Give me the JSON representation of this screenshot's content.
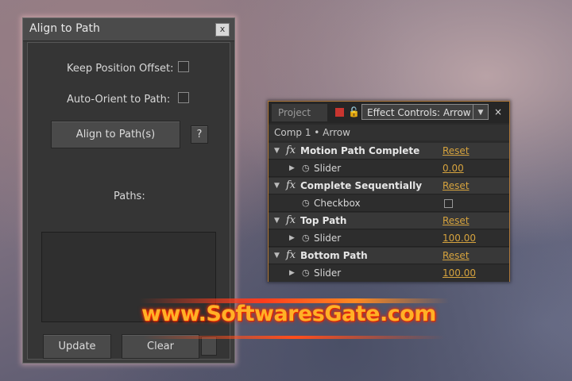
{
  "align_dialog": {
    "title": "Align to Path",
    "close_glyph": "x",
    "keep_position_offset_label": "Keep Position Offset:",
    "keep_position_offset_checked": false,
    "auto_orient_label": "Auto-Orient to Path:",
    "auto_orient_checked": false,
    "align_button_label": "Align to Path(s)",
    "help_button_label": "?",
    "paths_label": "Paths:",
    "update_button_label": "Update",
    "clear_button_label": "Clear"
  },
  "effect_controls": {
    "project_tab": "Project",
    "active_tab": "Effect Controls: Arrow",
    "tab_menu_glyph": "▼",
    "close_glyph": "×",
    "lock_icon": "lock-icon",
    "layer_header": "Comp 1 • Arrow",
    "effects": [
      {
        "name": "Motion Path Complete",
        "reset": "Reset",
        "prop": "Slider",
        "value": "0.00",
        "is_checkbox": false
      },
      {
        "name": "Complete Sequentially",
        "reset": "Reset",
        "prop": "Checkbox",
        "value": "",
        "is_checkbox": true
      },
      {
        "name": "Top Path",
        "reset": "Reset",
        "prop": "Slider",
        "value": "100.00",
        "is_checkbox": false
      },
      {
        "name": "Bottom Path",
        "reset": "Reset",
        "prop": "Slider",
        "value": "100.00",
        "is_checkbox": false
      }
    ],
    "accent_color": "#d6a33e"
  },
  "watermark": {
    "text": "www.SoftwaresGate.com",
    "color": "#ffb126"
  }
}
